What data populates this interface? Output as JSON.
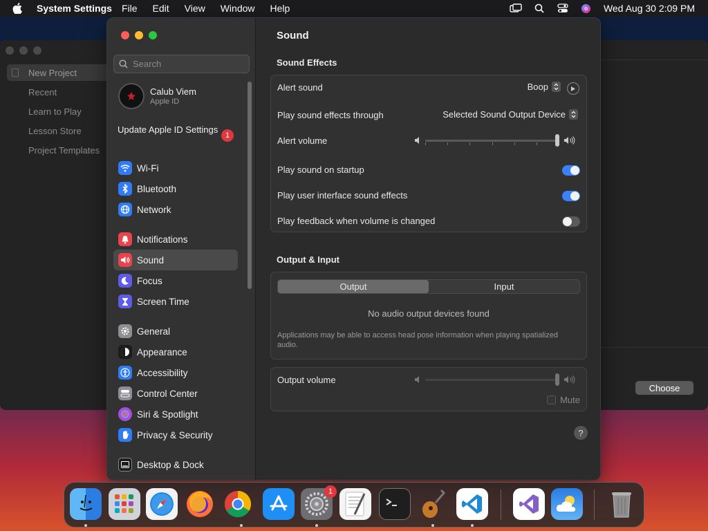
{
  "menubar": {
    "app_name": "System Settings",
    "items": [
      "File",
      "Edit",
      "View",
      "Window",
      "Help"
    ],
    "clock": "Wed Aug 30  2:09 PM"
  },
  "background_window": {
    "items": [
      "New Project",
      "Recent",
      "Learn to Play",
      "Lesson Store",
      "Project Templates"
    ],
    "choose_label": "Choose"
  },
  "sidebar": {
    "search_placeholder": "Search",
    "account": {
      "name": "Calub Viem",
      "subtitle": "Apple ID"
    },
    "update": {
      "label": "Update Apple ID Settings",
      "badge": "1"
    },
    "items": [
      {
        "label": "Wi-Fi",
        "icon": "wifi-icon",
        "color": "#2f7cf6"
      },
      {
        "label": "Bluetooth",
        "icon": "bluetooth-icon",
        "color": "#2f7cf6"
      },
      {
        "label": "Network",
        "icon": "globe-icon",
        "color": "#2f7cf6"
      },
      {
        "label": "Notifications",
        "icon": "bell-icon",
        "color": "#e9434e"
      },
      {
        "label": "Sound",
        "icon": "speaker-icon",
        "color": "#e9434e"
      },
      {
        "label": "Focus",
        "icon": "moon-icon",
        "color": "#5e5ce6"
      },
      {
        "label": "Screen Time",
        "icon": "hourglass-icon",
        "color": "#5e5ce6"
      },
      {
        "label": "General",
        "icon": "gear-icon",
        "color": "#8e8e93"
      },
      {
        "label": "Appearance",
        "icon": "appearance-icon",
        "color": "#1c1c1e"
      },
      {
        "label": "Accessibility",
        "icon": "accessibility-icon",
        "color": "#2f7cf6"
      },
      {
        "label": "Control Center",
        "icon": "control-center-icon",
        "color": "#8e8e93"
      },
      {
        "label": "Siri & Spotlight",
        "icon": "siri-icon",
        "color": "#b04bd8"
      },
      {
        "label": "Privacy & Security",
        "icon": "hand-icon",
        "color": "#2f7cf6"
      },
      {
        "label": "Desktop & Dock",
        "icon": "dock-icon",
        "color": "#1c1c1e"
      }
    ],
    "active": "Sound"
  },
  "content": {
    "title": "Sound",
    "sound_effects": {
      "section_title": "Sound Effects",
      "alert_sound_label": "Alert sound",
      "alert_sound_value": "Boop",
      "play_through_label": "Play sound effects through",
      "play_through_value": "Selected Sound Output Device",
      "alert_volume_label": "Alert volume",
      "alert_volume_level": 1.0,
      "startup_label": "Play sound on startup",
      "startup_on": true,
      "ui_sounds_label": "Play user interface sound effects",
      "ui_sounds_on": true,
      "feedback_label": "Play feedback when volume is changed",
      "feedback_on": false
    },
    "output_input": {
      "section_title": "Output & Input",
      "tab_output": "Output",
      "tab_input": "Input",
      "empty_message": "No audio output devices found",
      "note": "Applications may be able to access head pose information when playing spatialized audio.",
      "output_volume_label": "Output volume",
      "output_volume_level": 1.0,
      "mute_label": "Mute",
      "mute_checked": false
    },
    "help_label": "?"
  },
  "dock": {
    "apps": [
      "Finder",
      "Launchpad",
      "Safari",
      "Firefox",
      "Chrome",
      "App Store",
      "System Settings",
      "TextEdit",
      "Terminal",
      "GarageBand",
      "Visual Studio Code",
      "Visual Studio",
      "Weather",
      "Trash"
    ],
    "settings_badge": "1"
  },
  "colors": {
    "accent": "#2f7cf6",
    "toggle_on": "#3a82f7",
    "toggle_off": "#5a5a5a",
    "badge_red": "#e0383e"
  }
}
